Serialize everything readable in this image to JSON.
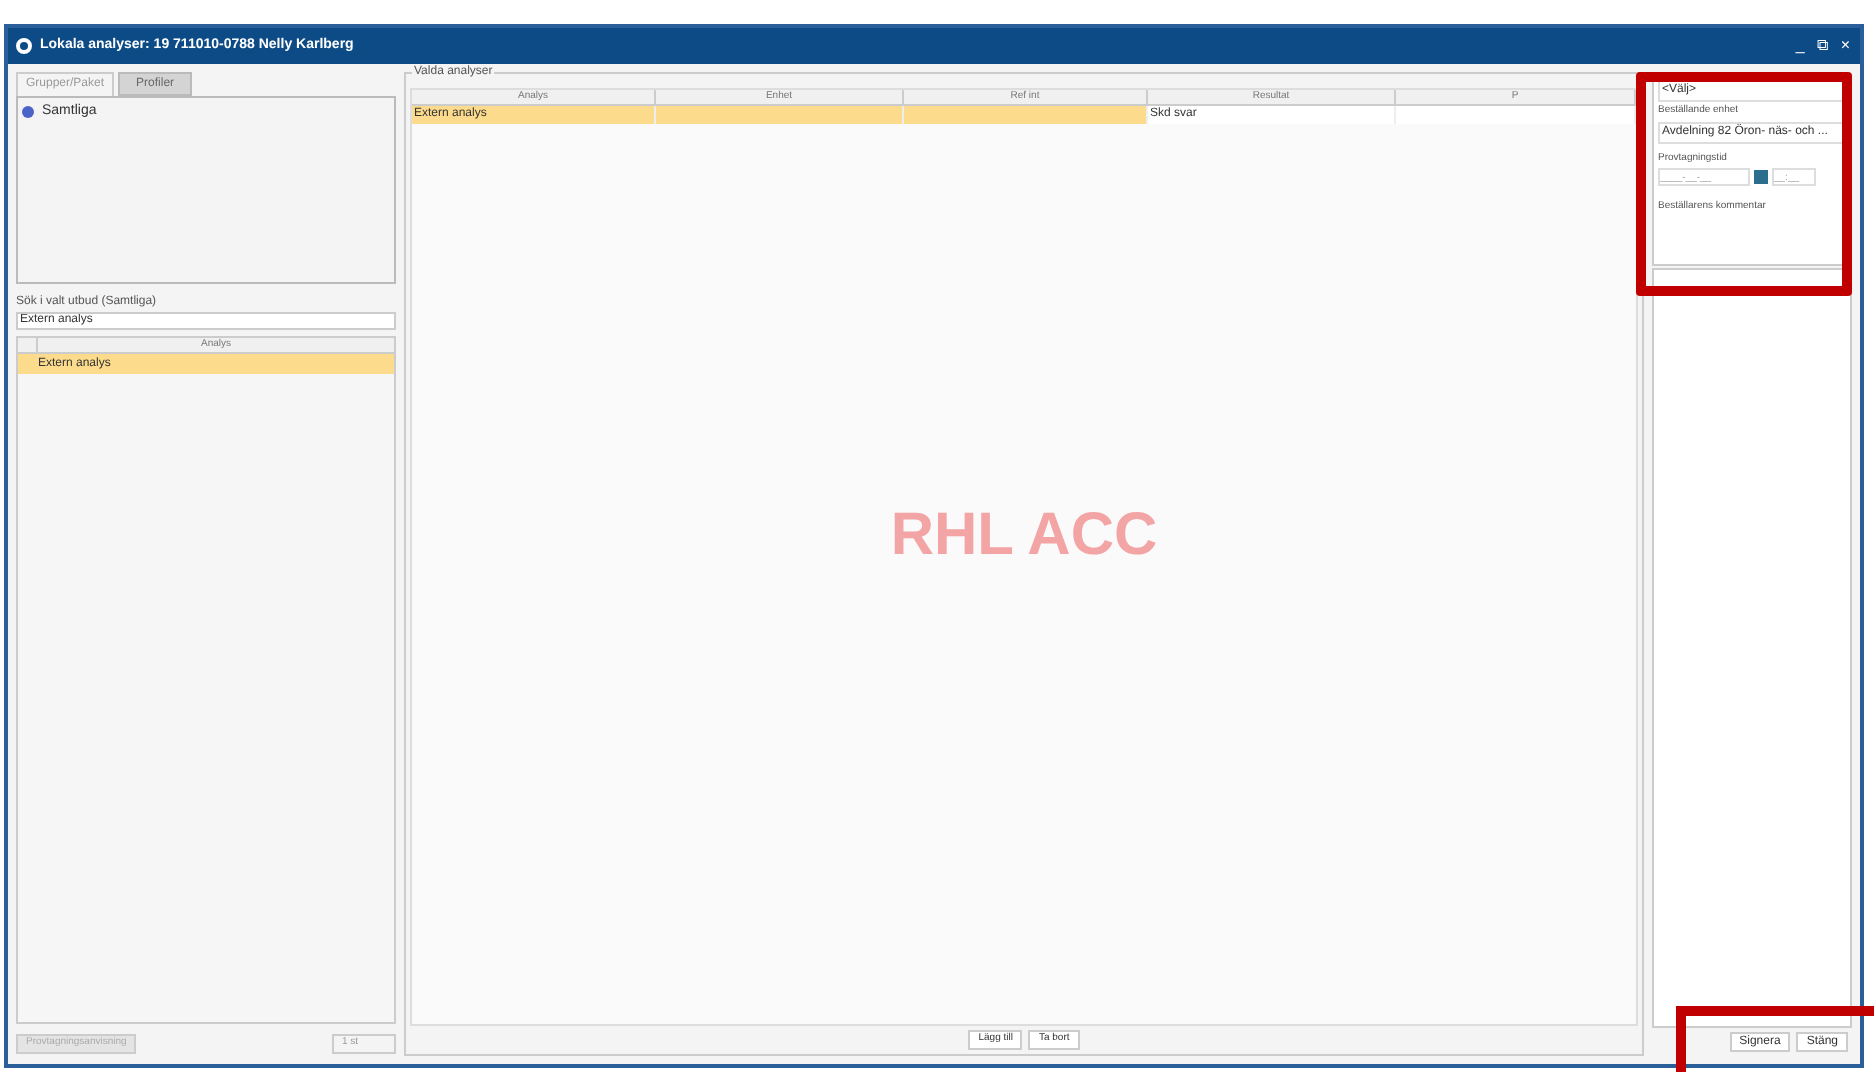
{
  "window": {
    "title": "Lokala analyser: 19 711010-0788 Nelly Karlberg",
    "controls": [
      "_",
      "⧉",
      "×"
    ]
  },
  "left_panel": {
    "tabs": [
      {
        "label": "Grupper/Paket",
        "selected": true
      },
      {
        "label": "Profiler",
        "selected": false
      }
    ],
    "tree": [
      {
        "label": "Samtliga"
      }
    ],
    "search_label": "Sök i valt utbud (Samtliga)",
    "search_value": "Extern analys",
    "list": {
      "columns": [
        "Analys"
      ],
      "rows": [
        {
          "cells": [
            "Extern analys"
          ],
          "selected": true
        }
      ]
    },
    "instructions_button": {
      "label": "Provtagningsanvisning",
      "disabled": true
    },
    "count": "1 st"
  },
  "selected_analyses": {
    "title": "Valda analyser",
    "columns": [
      "Analys",
      "Enhet",
      "Ref int",
      "Resultat",
      "P"
    ],
    "rows": [
      {
        "cells": [
          "Extern analys",
          "",
          "",
          "Skd svar",
          ""
        ],
        "selected": true
      }
    ],
    "environment_label": "RHL ACC",
    "buttons": [
      "Lägg till",
      "Ta bort"
    ]
  },
  "order_panel": {
    "select_value": "<Välj>",
    "unit_label": "Beställande enhet",
    "unit_value": "Avdelning 82 Öron- näs- och ...",
    "time_label": "Provtagningstid",
    "date_placeholder": "____-__-__",
    "time_placeholder": "__:__",
    "comment_label": "Beställarens kommentar",
    "highlighted": true
  },
  "footer_buttons": {
    "buttons": [
      "Signera",
      "Stäng"
    ],
    "highlighted": true
  }
}
